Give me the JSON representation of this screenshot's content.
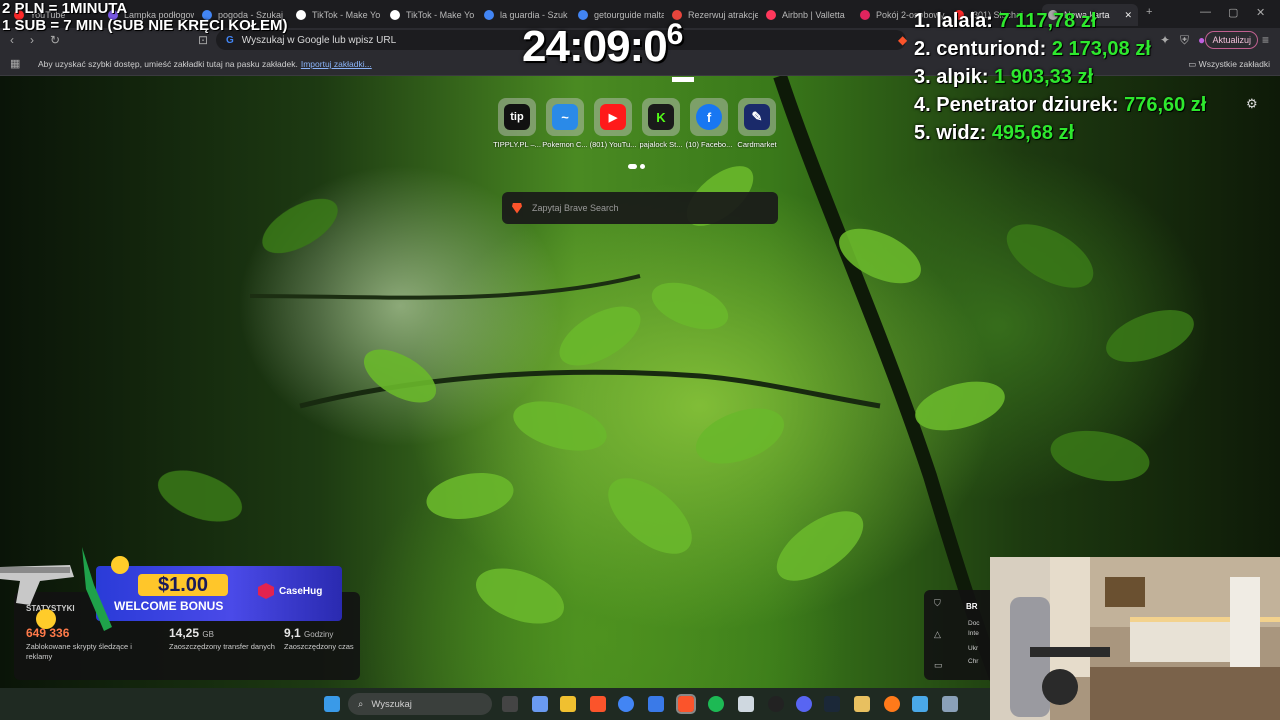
{
  "overlay": {
    "rules_line1": "2 PLN =  1MINUTA",
    "rules_line2": "1 SUB = 7 MIN (SUB NIE KRĘCI KOŁEM)",
    "timer_main": "24:09:0",
    "timer_sup": "6",
    "leaderboard": [
      {
        "rank": "1.",
        "name": "lalala:",
        "amount": "7 117,78 zł"
      },
      {
        "rank": "2.",
        "name": "centuriond:",
        "amount": "2 173,08 zł"
      },
      {
        "rank": "3.",
        "name": "alpik:",
        "amount": "1 903,33 zł"
      },
      {
        "rank": "4.",
        "name": "Penetrator dziurek:",
        "amount": "776,60 zł"
      },
      {
        "rank": "5.",
        "name": "widz:",
        "amount": "495,68 zł"
      }
    ]
  },
  "tabs": [
    {
      "label": "YouTube",
      "color": "#ff2a2a"
    },
    {
      "label": "Lampka podłogowa",
      "color": "#7a5ae8"
    },
    {
      "label": "pogoda - Szukaj",
      "color": "#4285f4"
    },
    {
      "label": "TikTok - Make Yo",
      "color": "#ffffff"
    },
    {
      "label": "TikTok - Make Yo",
      "color": "#ffffff"
    },
    {
      "label": "la guardia - Szuk",
      "color": "#4285f4"
    },
    {
      "label": "getourguide malta",
      "color": "#4285f4"
    },
    {
      "label": "Rezerwuj atrakcje",
      "color": "#e8453c"
    },
    {
      "label": "Airbnb | Valletta",
      "color": "#ff385c"
    },
    {
      "label": "Pokój 2-osobowy",
      "color": "#e0245e"
    },
    {
      "label": "(801) Słuchaj",
      "color": "#ff2a2a"
    },
    {
      "label": "Nowa karta",
      "color": "#aaaaaa"
    }
  ],
  "toolbar": {
    "omnibox_placeholder": "Wyszukaj w Google lub wpisz URL",
    "update_label": "Aktualizuj"
  },
  "bookmarks": {
    "message": "Aby uzyskać szybki dostęp, umieść zakładki tutaj na pasku zakładek.",
    "import_link": "Importuj zakładki...",
    "all_bookmarks": "Wszystkie zakładki"
  },
  "speed_dials": [
    {
      "label": "TIPPLY.PL –...",
      "icon": "tip",
      "bg": "#111111"
    },
    {
      "label": "Pokemon C...",
      "icon": "~",
      "bg": "#2a8ae8"
    },
    {
      "label": "(801) YouTu...",
      "icon": "▶",
      "bg": "#ff1a1a"
    },
    {
      "label": "pajalock St...",
      "icon": "K",
      "bg": "#1a1a1a"
    },
    {
      "label": "(10) Facebo...",
      "icon": "f",
      "bg": "#1877f2"
    },
    {
      "label": "Cardmarket",
      "icon": "✎",
      "bg": "#1a2a6a"
    }
  ],
  "search": {
    "placeholder": "Zapytaj Brave Search"
  },
  "stats": {
    "title": "STATYSTYKI",
    "trackers_value": "649 336",
    "trackers_desc": "Zablokowane skrypty śledzące i reklamy",
    "bandwidth_value": "14,25",
    "bandwidth_unit": "GB",
    "bandwidth_desc": "Zaoszczędzony transfer danych",
    "time_value": "9,1",
    "time_unit": "Godziny",
    "time_desc": "Zaoszczędzony czas"
  },
  "ad": {
    "bonus": "$1.00",
    "welcome": "WELCOME BONUS",
    "brand": "CaseHug"
  },
  "brave_panel": {
    "heading": "BR",
    "items": [
      "Doc",
      "Inte",
      "Ukr",
      "Chr"
    ]
  },
  "taskbar": {
    "search_label": "Wyszukaj"
  }
}
